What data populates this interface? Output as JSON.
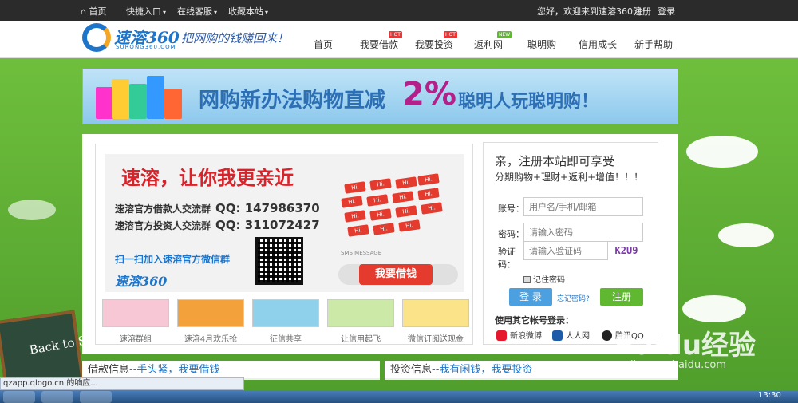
{
  "topbar": {
    "home": "首页",
    "quick": "快捷入口",
    "service": "在线客服",
    "favorite": "收藏本站",
    "welcome": "您好，欢迎来到速溶360网！",
    "register": "注册",
    "login": "登录"
  },
  "logo": {
    "name": "速溶360",
    "sub": "SURONG360.COM",
    "slogan": "把网购的钱赚回来！"
  },
  "nav": {
    "items": [
      {
        "label": "首页"
      },
      {
        "label": "我要借款",
        "badge": "HOT"
      },
      {
        "label": "我要投资",
        "badge": "HOT"
      },
      {
        "label": "返利网",
        "badge": "NEW"
      },
      {
        "label": "聪明购"
      },
      {
        "label": "信用成长"
      },
      {
        "label": "新手帮助"
      }
    ]
  },
  "banner": {
    "headline": "网购新办法购物直减",
    "percent": "2%",
    "tail": "聪明人玩聪明购！"
  },
  "promo": {
    "title": "速溶，让你我更亲近",
    "borrow_group": "速溶官方借款人交流群",
    "borrow_qq": "QQ: 147986370",
    "invest_group": "速溶官方投资人交流群",
    "invest_qq": "QQ: 311072427",
    "wechat": "扫一扫加入速溶官方微信群",
    "mini_logo": "速溶360",
    "sms": "SMS MESSAGE",
    "borrow_btn": "我要借钱",
    "hi": "Hi."
  },
  "thumbs": [
    {
      "caption": "速溶群组"
    },
    {
      "caption": "速溶4月欢乐抢"
    },
    {
      "caption": "征信共享"
    },
    {
      "caption": "让信用起飞"
    },
    {
      "caption": "微信订阅送现金"
    }
  ],
  "register": {
    "title": "亲，注册本站即可享受",
    "subtitle": "分期购物+理财+返利+增值！！！",
    "account_label": "账号：",
    "account_placeholder": "用户名/手机/邮箱",
    "password_label": "密码：",
    "password_placeholder": "请输入密码",
    "captcha_label_1": "验证",
    "captcha_label_2": "码：",
    "captcha_placeholder": "请输入验证码",
    "captcha_text": "K2U9",
    "remember": "记住密码",
    "login_btn": "登 录",
    "forgot": "忘记密码?",
    "register_btn": "注册",
    "other_login": "使用其它帐号登录：",
    "sina": "新浪微博",
    "renren": "人人网",
    "qq": "腾讯QQ"
  },
  "info": {
    "borrow_title": "借款信息",
    "borrow_slogan": "--手头紧，我要借钱",
    "invest_title": "投资信息",
    "invest_slogan": "--我有闲钱，我要投资"
  },
  "decor": {
    "blackboard": "Back to School"
  },
  "status": {
    "text": "qzapp.qlogo.cn 的响应..."
  },
  "taskbar": {
    "time": "13:30"
  },
  "watermark": {
    "main": "Baidu经验",
    "sub": "jingyan.baidu.com"
  },
  "colors": {
    "brand_blue": "#1d74c9",
    "accent_red": "#d8232a",
    "register_green": "#5fb830",
    "login_blue": "#4da0e0"
  }
}
